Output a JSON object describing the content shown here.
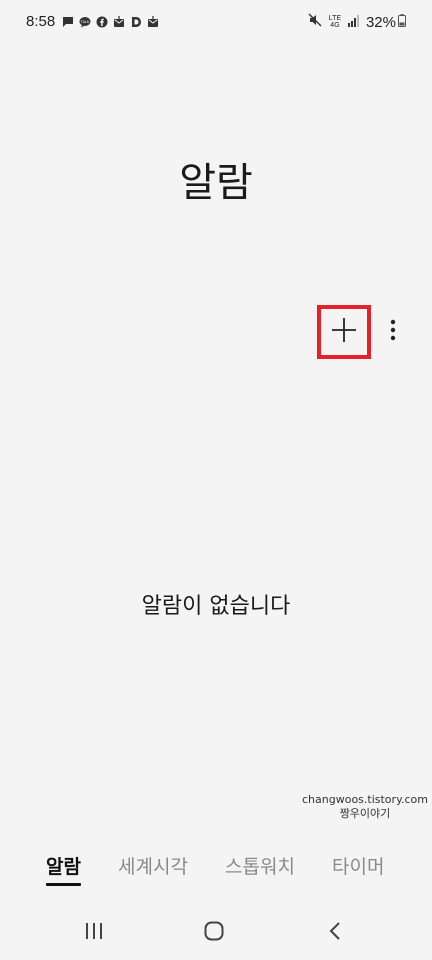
{
  "status_bar": {
    "time": "8:58",
    "network_label_top": "LTE",
    "network_label_bottom": "4G",
    "battery_percent": "32%",
    "notification_icons": [
      "message-icon",
      "talk-icon",
      "facebook-icon",
      "mail-icon",
      "d-app-icon",
      "mail-icon"
    ]
  },
  "page": {
    "title": "알람",
    "empty_message": "알람이 없습니다"
  },
  "toolbar": {
    "add_icon": "plus-icon",
    "more_icon": "more-vertical-icon",
    "highlight_color": "#e8202a"
  },
  "watermark": {
    "line1": "changwoos.tistory.com",
    "line2": "짱우이야기"
  },
  "tabs": [
    {
      "label": "알람",
      "active": true
    },
    {
      "label": "세계시각",
      "active": false
    },
    {
      "label": "스톱워치",
      "active": false
    },
    {
      "label": "타이머",
      "active": false
    }
  ],
  "nav": {
    "recent_icon": "recent-apps-icon",
    "home_icon": "home-icon",
    "back_icon": "back-icon"
  }
}
